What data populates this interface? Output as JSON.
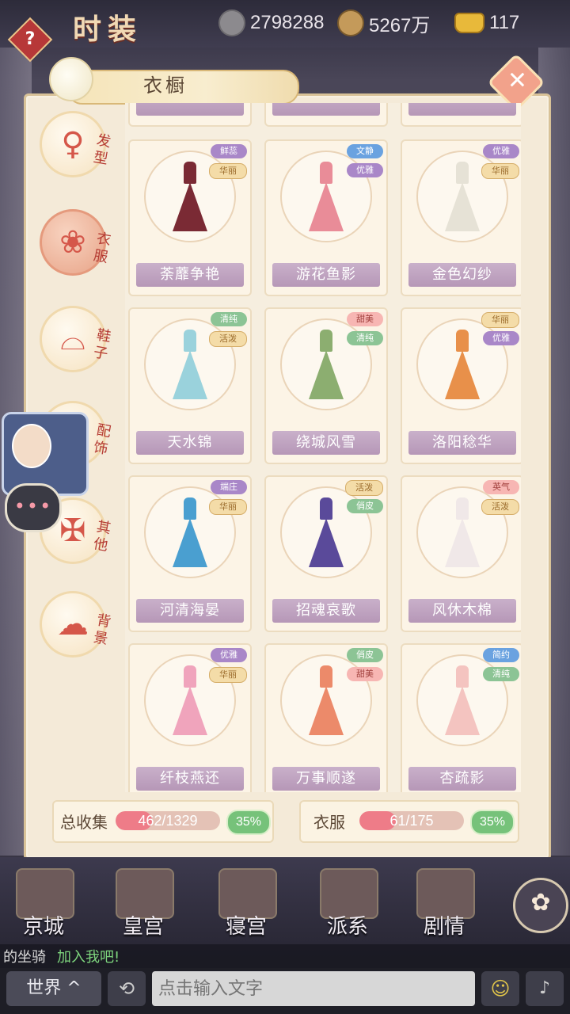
{
  "header": {
    "title": "时装",
    "help_label": "?",
    "resources": [
      {
        "name": "silver-coin",
        "value": "2798288"
      },
      {
        "name": "copper-coin",
        "value": "5267万"
      },
      {
        "name": "gold-ingot",
        "value": "117"
      }
    ]
  },
  "panel": {
    "title": "衣橱",
    "close_label": "✕"
  },
  "categories": [
    {
      "label": "发型",
      "icon": "hairstyle-icon",
      "glyph": "♀"
    },
    {
      "label": "衣服",
      "icon": "clothes-icon",
      "glyph": "❀",
      "active": true
    },
    {
      "label": "鞋子",
      "icon": "shoes-icon",
      "glyph": "⌓"
    },
    {
      "label": "配饰",
      "icon": "accessory-icon",
      "glyph": "✿"
    },
    {
      "label": "其他",
      "icon": "knot-icon",
      "glyph": "✠"
    },
    {
      "label": "背景",
      "icon": "background-icon",
      "glyph": "☁"
    }
  ],
  "outfits": [
    {
      "name": "荼蘼争艳",
      "tags": [
        "鲜蕊",
        "华丽"
      ],
      "tag_colors": [
        "purple",
        "gold"
      ],
      "color": "#7a2a34"
    },
    {
      "name": "游花鱼影",
      "tags": [
        "文静",
        "优雅"
      ],
      "tag_colors": [
        "blue",
        "purple"
      ],
      "color": "#e98c98"
    },
    {
      "name": "金色幻纱",
      "tags": [
        "优雅",
        "华丽"
      ],
      "tag_colors": [
        "purple",
        "gold"
      ],
      "color": "#e6e2d6"
    },
    {
      "name": "天水锦",
      "tags": [
        "清纯",
        "活泼"
      ],
      "tag_colors": [
        "green",
        "gold"
      ],
      "color": "#9ad2dc"
    },
    {
      "name": "绕城风雪",
      "tags": [
        "甜美",
        "清纯"
      ],
      "tag_colors": [
        "pink",
        "green"
      ],
      "color": "#8cae70"
    },
    {
      "name": "洛阳稔华",
      "tags": [
        "华丽",
        "优雅"
      ],
      "tag_colors": [
        "gold",
        "purple"
      ],
      "color": "#e8904a"
    },
    {
      "name": "河清海晏",
      "tags": [
        "端庄",
        "华丽"
      ],
      "tag_colors": [
        "purple",
        "gold"
      ],
      "color": "#4a9fd0"
    },
    {
      "name": "招魂哀歌",
      "tags": [
        "活泼",
        "俏皮"
      ],
      "tag_colors": [
        "gold",
        "green"
      ],
      "color": "#5a4a9a"
    },
    {
      "name": "风休木棉",
      "tags": [
        "英气",
        "活泼"
      ],
      "tag_colors": [
        "pink",
        "gold"
      ],
      "color": "#f0e8e8"
    },
    {
      "name": "纤枝燕还",
      "tags": [
        "优雅",
        "华丽"
      ],
      "tag_colors": [
        "purple",
        "gold"
      ],
      "color": "#f0a4bc"
    },
    {
      "name": "万事顺遂",
      "tags": [
        "俏皮",
        "甜美"
      ],
      "tag_colors": [
        "green",
        "pink"
      ],
      "color": "#ec8a6a"
    },
    {
      "name": "杏疏影",
      "tags": [
        "简约",
        "清纯"
      ],
      "tag_colors": [
        "blue",
        "green"
      ],
      "color": "#f4c4c0"
    }
  ],
  "stats": {
    "total_label": "总收集",
    "total_value": "462/1329",
    "total_fraction": 0.35,
    "total_pct": "35%",
    "category_label": "衣服",
    "category_value": "61/175",
    "category_fraction": 0.35,
    "category_pct": "35%"
  },
  "nav": [
    {
      "label": "京城",
      "icon": "map-icon"
    },
    {
      "label": "皇宫",
      "icon": "palace-icon"
    },
    {
      "label": "寝宫",
      "icon": "bedchamber-icon"
    },
    {
      "label": "派系",
      "icon": "faction-icon"
    },
    {
      "label": "剧情",
      "icon": "story-book-icon"
    }
  ],
  "chat": {
    "sender": "的坐骑",
    "link_text": "加入我吧!",
    "channel_label": "世界 ^",
    "input_placeholder": "点击输入文字"
  }
}
